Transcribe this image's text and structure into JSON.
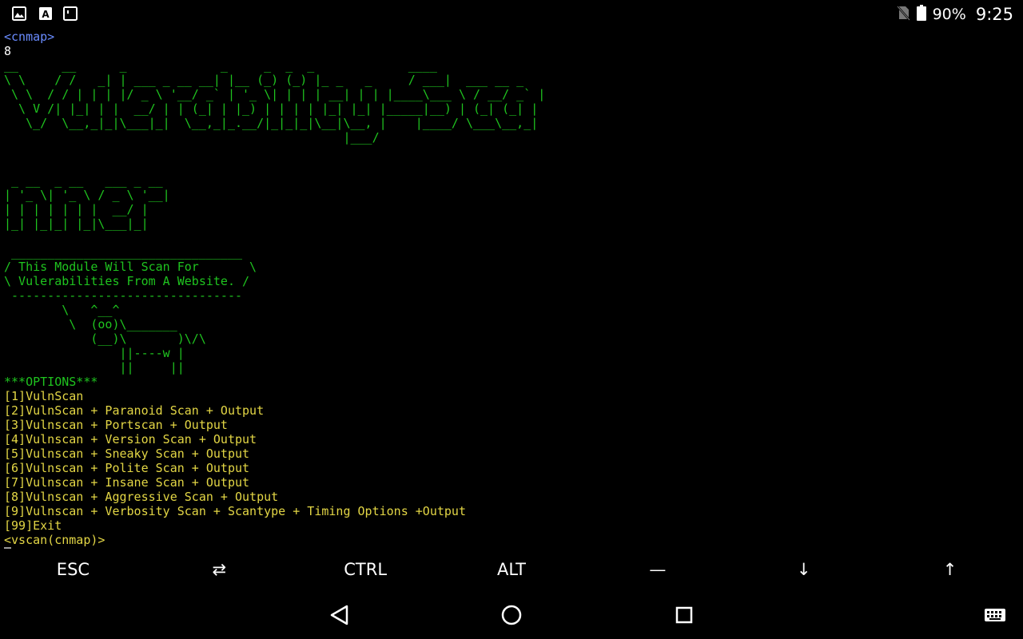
{
  "status_bar": {
    "left_icons": [
      "image-icon",
      "text-icon",
      "terminal-icon"
    ],
    "battery_percent": "90%",
    "time": "9:25"
  },
  "terminal": {
    "colors": {
      "prompt_blue": "#6a8cff",
      "banner_green": "#1fc41f",
      "menu_yellow": "#e3d645",
      "plain_white": "#ffffff"
    },
    "lines": [
      {
        "c": "blue",
        "t": "<cnmap>"
      },
      {
        "c": "white",
        "t": "8"
      },
      {
        "c": "green",
        "t": "__      __      _             _     _  _  _             ____"
      },
      {
        "c": "green",
        "t": "\\ \\    / /   _| | ___ _ __ __| |__ (_) (_) |_ _   _     / ___|  ___ __ _"
      },
      {
        "c": "green",
        "t": " \\ \\  / / | | | |/ _ \\ '__/ _` | '_ \\| | | | __| | | |____\\___ \\ / __/ _` |"
      },
      {
        "c": "green",
        "t": "  \\ V /| |_| | |  __/ | | (_| | |_) | | | | |_| |_| |_____|__) | (_| (_| |"
      },
      {
        "c": "green",
        "t": "   \\_/  \\__,_|_|\\___|_|  \\__,_|_.__/|_|_|_|\\__|\\__, |    |____/ \\___\\__,_|"
      },
      {
        "c": "green",
        "t": "                                               |___/"
      },
      {
        "c": "green",
        "t": ""
      },
      {
        "c": "green",
        "t": ""
      },
      {
        "c": "green",
        "t": " _ __  _ __   ___ _ __"
      },
      {
        "c": "green",
        "t": "| '_ \\| '_ \\ / _ \\ '__|"
      },
      {
        "c": "green",
        "t": "| | | | | | |  __/ |"
      },
      {
        "c": "green",
        "t": "|_| |_|_| |_|\\___|_|"
      },
      {
        "c": "green",
        "t": ""
      },
      {
        "c": "green",
        "t": " ________________________________"
      },
      {
        "c": "green",
        "t": "/ This Module Will Scan For       \\"
      },
      {
        "c": "green",
        "t": "\\ Vulerabilities From A Website. /"
      },
      {
        "c": "green",
        "t": " --------------------------------"
      },
      {
        "c": "green",
        "t": "        \\   ^__^"
      },
      {
        "c": "green",
        "t": "         \\  (oo)\\_______"
      },
      {
        "c": "green",
        "t": "            (__)\\       )\\/\\"
      },
      {
        "c": "green",
        "t": "                ||----w |"
      },
      {
        "c": "green",
        "t": "                ||     ||"
      },
      {
        "c": "green",
        "t": "***OPTIONS***"
      },
      {
        "c": "yellow",
        "t": "[1]VulnScan"
      },
      {
        "c": "yellow",
        "t": "[2]VulnScan + Paranoid Scan + Output"
      },
      {
        "c": "yellow",
        "t": "[3]Vulnscan + Portscan + Output"
      },
      {
        "c": "yellow",
        "t": "[4]Vulnscan + Version Scan + Output"
      },
      {
        "c": "yellow",
        "t": "[5]Vulnscan + Sneaky Scan + Output"
      },
      {
        "c": "yellow",
        "t": "[6]Vulnscan + Polite Scan + Output"
      },
      {
        "c": "yellow",
        "t": "[7]Vulnscan + Insane Scan + Output"
      },
      {
        "c": "yellow",
        "t": "[8]Vulnscan + Aggressive Scan + Output"
      },
      {
        "c": "yellow",
        "t": "[9]Vulnscan + Verbosity Scan + Scantype + Timing Options +Output"
      },
      {
        "c": "yellow",
        "t": "[99]Exit"
      },
      {
        "c": "yellow",
        "t": "<vscan(cnmap)>"
      }
    ]
  },
  "extra_keys": [
    "ESC",
    "⇄",
    "CTRL",
    "ALT",
    "—",
    "↓",
    "↑"
  ],
  "nav_bar": {
    "buttons": [
      "back-icon",
      "home-icon",
      "recents-icon",
      "keyboard-icon"
    ]
  }
}
